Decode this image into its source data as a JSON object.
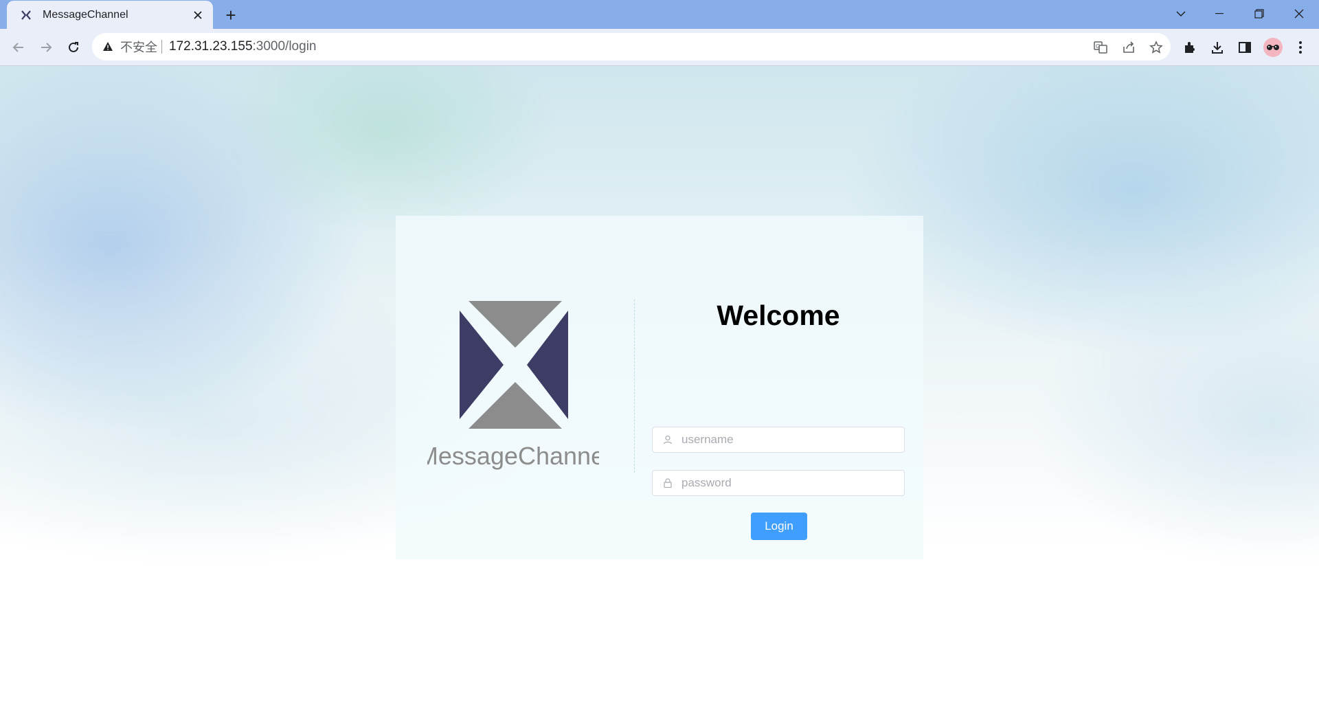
{
  "browser": {
    "tab_title": "MessageChannel",
    "new_tab_symbol": "+",
    "security_label": "不安全",
    "url_host": "172.31.23.155",
    "url_rest": ":3000/login"
  },
  "login": {
    "brand_name": "MessageChannel",
    "heading": "Welcome",
    "username_placeholder": "username",
    "password_placeholder": "password",
    "submit_label": "Login"
  },
  "colors": {
    "logo_gray": "#8c8c8c",
    "logo_navy": "#3c3c64",
    "button_blue": "#409eff"
  }
}
